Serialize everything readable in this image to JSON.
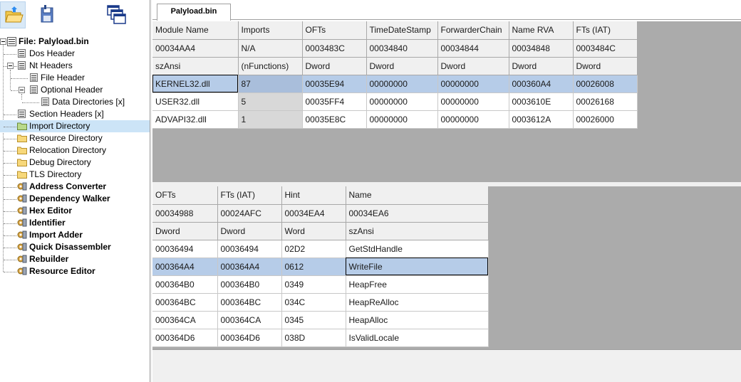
{
  "toolbar": {
    "buttons": [
      {
        "icon": "open-folder-icon"
      },
      {
        "icon": "save-icon"
      },
      {
        "icon": "windows-icon"
      }
    ]
  },
  "tree": {
    "root": "File: Palyload.bin",
    "dos_header": "Dos Header",
    "nt_headers": "Nt Headers",
    "file_header": "File Header",
    "optional_header": "Optional Header",
    "data_directories": "Data Directories [x]",
    "section_headers": "Section Headers [x]",
    "import_directory": "Import Directory",
    "resource_directory": "Resource Directory",
    "relocation_directory": "Relocation Directory",
    "debug_directory": "Debug Directory",
    "tls_directory": "TLS Directory",
    "tools": [
      "Address Converter",
      "Dependency Walker",
      "Hex Editor",
      "Identifier",
      "Import Adder",
      "Quick Disassembler",
      "Rebuilder",
      "Resource Editor"
    ]
  },
  "tab": {
    "label": "Palyload.bin"
  },
  "imports_table": {
    "headers": [
      "Module Name",
      "Imports",
      "OFTs",
      "TimeDateStamp",
      "ForwarderChain",
      "Name RVA",
      "FTs (IAT)"
    ],
    "offsets": [
      "00034AA4",
      "N/A",
      "0003483C",
      "00034840",
      "00034844",
      "00034848",
      "0003484C"
    ],
    "types": [
      "szAnsi",
      "(nFunctions)",
      "Dword",
      "Dword",
      "Dword",
      "Dword",
      "Dword"
    ],
    "rows": [
      [
        "KERNEL32.dll",
        "87",
        "00035E94",
        "00000000",
        "00000000",
        "000360A4",
        "00026008"
      ],
      [
        "USER32.dll",
        "5",
        "00035FF4",
        "00000000",
        "00000000",
        "0003610E",
        "00026168"
      ],
      [
        "ADVAPI32.dll",
        "1",
        "00035E8C",
        "00000000",
        "00000000",
        "0003612A",
        "00026000"
      ]
    ],
    "selected_row": 0
  },
  "functions_table": {
    "headers": [
      "OFTs",
      "FTs (IAT)",
      "Hint",
      "Name"
    ],
    "offsets": [
      "00034988",
      "00024AFC",
      "00034EA4",
      "00034EA6"
    ],
    "types": [
      "Dword",
      "Dword",
      "Word",
      "szAnsi"
    ],
    "rows": [
      [
        "00036494",
        "00036494",
        "02D2",
        "GetStdHandle"
      ],
      [
        "000364A4",
        "000364A4",
        "0612",
        "WriteFile"
      ],
      [
        "000364B0",
        "000364B0",
        "0349",
        "HeapFree"
      ],
      [
        "000364BC",
        "000364BC",
        "034C",
        "HeapReAlloc"
      ],
      [
        "000364CA",
        "000364CA",
        "0345",
        "HeapAlloc"
      ],
      [
        "000364D6",
        "000364D6",
        "038D",
        "IsValidLocale"
      ]
    ],
    "selected_row": 1
  }
}
